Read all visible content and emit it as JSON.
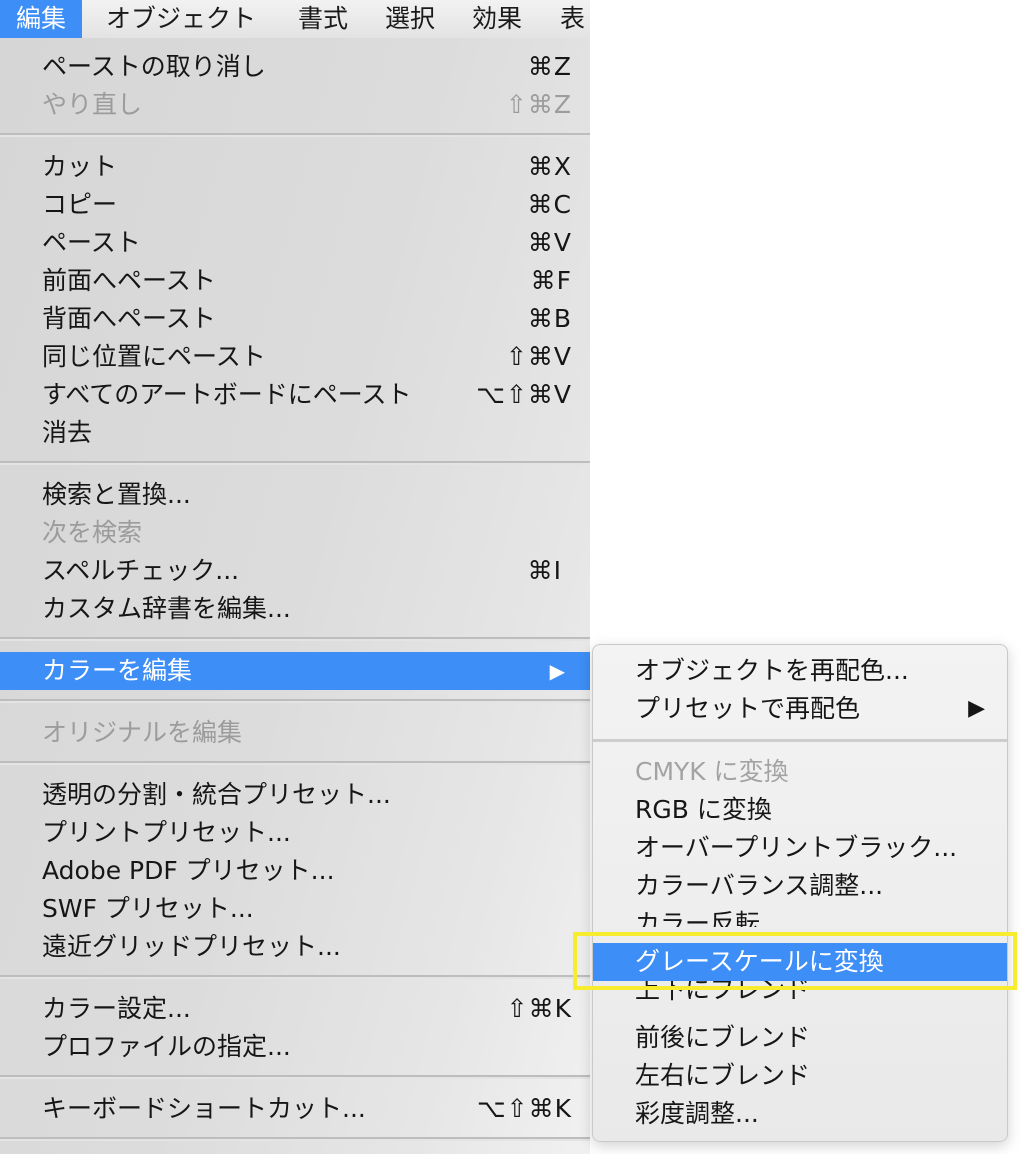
{
  "menubar": {
    "items": [
      {
        "label": "編集",
        "active": true
      },
      {
        "label": "オブジェクト"
      },
      {
        "label": "書式"
      },
      {
        "label": "選択"
      },
      {
        "label": "効果"
      },
      {
        "label": "表"
      }
    ]
  },
  "edit_menu": {
    "items": [
      {
        "label": "ペーストの取り消し",
        "shortcut": "⌘Z"
      },
      {
        "label": "やり直し",
        "shortcut": "⇧⌘Z",
        "disabled": true
      },
      {
        "label": "カット",
        "shortcut": "⌘X"
      },
      {
        "label": "コピー",
        "shortcut": "⌘C"
      },
      {
        "label": "ペースト",
        "shortcut": "⌘V"
      },
      {
        "label": "前面へペースト",
        "shortcut": "⌘F"
      },
      {
        "label": "背面へペースト",
        "shortcut": "⌘B"
      },
      {
        "label": "同じ位置にペースト",
        "shortcut": "⇧⌘V"
      },
      {
        "label": "すべてのアートボードにペースト",
        "shortcut": "⌥⇧⌘V"
      },
      {
        "label": "消去",
        "shortcut": ""
      },
      {
        "label": "検索と置換...",
        "shortcut": ""
      },
      {
        "label": "次を検索",
        "shortcut": "",
        "disabled": true
      },
      {
        "label": "スペルチェック...",
        "shortcut": "⌘I"
      },
      {
        "label": "カスタム辞書を編集...",
        "shortcut": ""
      },
      {
        "label": "カラーを編集",
        "shortcut": "▶",
        "highlighted": true
      },
      {
        "label": "オリジナルを編集",
        "shortcut": "",
        "disabled": true
      },
      {
        "label": "透明の分割・統合プリセット...",
        "shortcut": ""
      },
      {
        "label": "プリントプリセット...",
        "shortcut": ""
      },
      {
        "label": "Adobe PDF プリセット...",
        "shortcut": ""
      },
      {
        "label": "SWF プリセット...",
        "shortcut": ""
      },
      {
        "label": "遠近グリッドプリセット...",
        "shortcut": ""
      },
      {
        "label": "カラー設定...",
        "shortcut": "⇧⌘K"
      },
      {
        "label": "プロファイルの指定...",
        "shortcut": ""
      },
      {
        "label": "キーボードショートカット...",
        "shortcut": "⌥⇧⌘K"
      }
    ]
  },
  "color_submenu": {
    "items": [
      {
        "label": "オブジェクトを再配色..."
      },
      {
        "label": "プリセットで再配色",
        "arrow": "▶"
      },
      {
        "label": "CMYK に変換",
        "disabled": true
      },
      {
        "label": "RGB に変換"
      },
      {
        "label": "オーバープリントブラック..."
      },
      {
        "label": "カラーバランス調整..."
      },
      {
        "label": "カラー反転"
      },
      {
        "label": "グレースケールに変換",
        "highlighted": true
      },
      {
        "label": "上下にブレンド"
      },
      {
        "label": "前後にブレンド"
      },
      {
        "label": "左右にブレンド"
      },
      {
        "label": "彩度調整..."
      }
    ]
  },
  "colors": {
    "highlight": "#3d8ef6",
    "callout": "#f7ec2e"
  }
}
